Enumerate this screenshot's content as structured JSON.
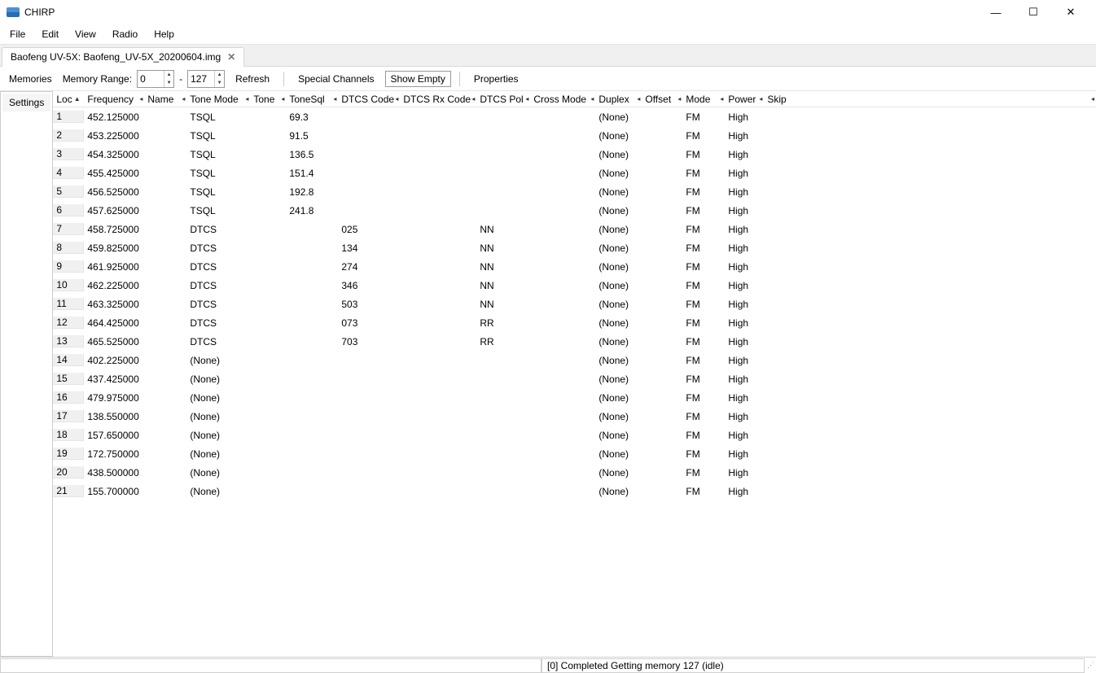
{
  "title": "CHIRP",
  "menu": {
    "file": "File",
    "edit": "Edit",
    "view": "View",
    "radio": "Radio",
    "help": "Help"
  },
  "tab": {
    "label": "Baofeng UV-5X: Baofeng_UV-5X_20200604.img"
  },
  "toolbar": {
    "memories": "Memories",
    "memory_range": "Memory Range:",
    "range_from": "0",
    "dash": "-",
    "range_to": "127",
    "refresh": "Refresh",
    "special_channels": "Special Channels",
    "show_empty": "Show Empty",
    "properties": "Properties"
  },
  "sidebar": {
    "settings": "Settings"
  },
  "columns": {
    "loc": "Loc",
    "frequency": "Frequency",
    "name": "Name",
    "tone_mode": "Tone Mode",
    "tone": "Tone",
    "tone_sql": "ToneSql",
    "dtcs_code": "DTCS Code",
    "dtcs_rx_code": "DTCS Rx Code",
    "dtcs_pol": "DTCS Pol",
    "cross_mode": "Cross Mode",
    "duplex": "Duplex",
    "offset": "Offset",
    "mode": "Mode",
    "power": "Power",
    "skip": "Skip"
  },
  "rows": [
    {
      "loc": "1",
      "freq": "452.125000",
      "name": "",
      "tmode": "TSQL",
      "tone": "",
      "tsql": "69.3",
      "dtcs": "",
      "dtcsrx": "",
      "dtcspol": "",
      "cross": "",
      "duplex": "(None)",
      "offset": "",
      "mode": "FM",
      "power": "High",
      "skip": ""
    },
    {
      "loc": "2",
      "freq": "453.225000",
      "name": "",
      "tmode": "TSQL",
      "tone": "",
      "tsql": "91.5",
      "dtcs": "",
      "dtcsrx": "",
      "dtcspol": "",
      "cross": "",
      "duplex": "(None)",
      "offset": "",
      "mode": "FM",
      "power": "High",
      "skip": ""
    },
    {
      "loc": "3",
      "freq": "454.325000",
      "name": "",
      "tmode": "TSQL",
      "tone": "",
      "tsql": "136.5",
      "dtcs": "",
      "dtcsrx": "",
      "dtcspol": "",
      "cross": "",
      "duplex": "(None)",
      "offset": "",
      "mode": "FM",
      "power": "High",
      "skip": ""
    },
    {
      "loc": "4",
      "freq": "455.425000",
      "name": "",
      "tmode": "TSQL",
      "tone": "",
      "tsql": "151.4",
      "dtcs": "",
      "dtcsrx": "",
      "dtcspol": "",
      "cross": "",
      "duplex": "(None)",
      "offset": "",
      "mode": "FM",
      "power": "High",
      "skip": ""
    },
    {
      "loc": "5",
      "freq": "456.525000",
      "name": "",
      "tmode": "TSQL",
      "tone": "",
      "tsql": "192.8",
      "dtcs": "",
      "dtcsrx": "",
      "dtcspol": "",
      "cross": "",
      "duplex": "(None)",
      "offset": "",
      "mode": "FM",
      "power": "High",
      "skip": ""
    },
    {
      "loc": "6",
      "freq": "457.625000",
      "name": "",
      "tmode": "TSQL",
      "tone": "",
      "tsql": "241.8",
      "dtcs": "",
      "dtcsrx": "",
      "dtcspol": "",
      "cross": "",
      "duplex": "(None)",
      "offset": "",
      "mode": "FM",
      "power": "High",
      "skip": ""
    },
    {
      "loc": "7",
      "freq": "458.725000",
      "name": "",
      "tmode": "DTCS",
      "tone": "",
      "tsql": "",
      "dtcs": "025",
      "dtcsrx": "",
      "dtcspol": "NN",
      "cross": "",
      "duplex": "(None)",
      "offset": "",
      "mode": "FM",
      "power": "High",
      "skip": ""
    },
    {
      "loc": "8",
      "freq": "459.825000",
      "name": "",
      "tmode": "DTCS",
      "tone": "",
      "tsql": "",
      "dtcs": "134",
      "dtcsrx": "",
      "dtcspol": "NN",
      "cross": "",
      "duplex": "(None)",
      "offset": "",
      "mode": "FM",
      "power": "High",
      "skip": ""
    },
    {
      "loc": "9",
      "freq": "461.925000",
      "name": "",
      "tmode": "DTCS",
      "tone": "",
      "tsql": "",
      "dtcs": "274",
      "dtcsrx": "",
      "dtcspol": "NN",
      "cross": "",
      "duplex": "(None)",
      "offset": "",
      "mode": "FM",
      "power": "High",
      "skip": ""
    },
    {
      "loc": "10",
      "freq": "462.225000",
      "name": "",
      "tmode": "DTCS",
      "tone": "",
      "tsql": "",
      "dtcs": "346",
      "dtcsrx": "",
      "dtcspol": "NN",
      "cross": "",
      "duplex": "(None)",
      "offset": "",
      "mode": "FM",
      "power": "High",
      "skip": ""
    },
    {
      "loc": "11",
      "freq": "463.325000",
      "name": "",
      "tmode": "DTCS",
      "tone": "",
      "tsql": "",
      "dtcs": "503",
      "dtcsrx": "",
      "dtcspol": "NN",
      "cross": "",
      "duplex": "(None)",
      "offset": "",
      "mode": "FM",
      "power": "High",
      "skip": ""
    },
    {
      "loc": "12",
      "freq": "464.425000",
      "name": "",
      "tmode": "DTCS",
      "tone": "",
      "tsql": "",
      "dtcs": "073",
      "dtcsrx": "",
      "dtcspol": "RR",
      "cross": "",
      "duplex": "(None)",
      "offset": "",
      "mode": "FM",
      "power": "High",
      "skip": ""
    },
    {
      "loc": "13",
      "freq": "465.525000",
      "name": "",
      "tmode": "DTCS",
      "tone": "",
      "tsql": "",
      "dtcs": "703",
      "dtcsrx": "",
      "dtcspol": "RR",
      "cross": "",
      "duplex": "(None)",
      "offset": "",
      "mode": "FM",
      "power": "High",
      "skip": ""
    },
    {
      "loc": "14",
      "freq": "402.225000",
      "name": "",
      "tmode": "(None)",
      "tone": "",
      "tsql": "",
      "dtcs": "",
      "dtcsrx": "",
      "dtcspol": "",
      "cross": "",
      "duplex": "(None)",
      "offset": "",
      "mode": "FM",
      "power": "High",
      "skip": ""
    },
    {
      "loc": "15",
      "freq": "437.425000",
      "name": "",
      "tmode": "(None)",
      "tone": "",
      "tsql": "",
      "dtcs": "",
      "dtcsrx": "",
      "dtcspol": "",
      "cross": "",
      "duplex": "(None)",
      "offset": "",
      "mode": "FM",
      "power": "High",
      "skip": ""
    },
    {
      "loc": "16",
      "freq": "479.975000",
      "name": "",
      "tmode": "(None)",
      "tone": "",
      "tsql": "",
      "dtcs": "",
      "dtcsrx": "",
      "dtcspol": "",
      "cross": "",
      "duplex": "(None)",
      "offset": "",
      "mode": "FM",
      "power": "High",
      "skip": ""
    },
    {
      "loc": "17",
      "freq": "138.550000",
      "name": "",
      "tmode": "(None)",
      "tone": "",
      "tsql": "",
      "dtcs": "",
      "dtcsrx": "",
      "dtcspol": "",
      "cross": "",
      "duplex": "(None)",
      "offset": "",
      "mode": "FM",
      "power": "High",
      "skip": ""
    },
    {
      "loc": "18",
      "freq": "157.650000",
      "name": "",
      "tmode": "(None)",
      "tone": "",
      "tsql": "",
      "dtcs": "",
      "dtcsrx": "",
      "dtcspol": "",
      "cross": "",
      "duplex": "(None)",
      "offset": "",
      "mode": "FM",
      "power": "High",
      "skip": ""
    },
    {
      "loc": "19",
      "freq": "172.750000",
      "name": "",
      "tmode": "(None)",
      "tone": "",
      "tsql": "",
      "dtcs": "",
      "dtcsrx": "",
      "dtcspol": "",
      "cross": "",
      "duplex": "(None)",
      "offset": "",
      "mode": "FM",
      "power": "High",
      "skip": ""
    },
    {
      "loc": "20",
      "freq": "438.500000",
      "name": "",
      "tmode": "(None)",
      "tone": "",
      "tsql": "",
      "dtcs": "",
      "dtcsrx": "",
      "dtcspol": "",
      "cross": "",
      "duplex": "(None)",
      "offset": "",
      "mode": "FM",
      "power": "High",
      "skip": ""
    },
    {
      "loc": "21",
      "freq": "155.700000",
      "name": "",
      "tmode": "(None)",
      "tone": "",
      "tsql": "",
      "dtcs": "",
      "dtcsrx": "",
      "dtcspol": "",
      "cross": "",
      "duplex": "(None)",
      "offset": "",
      "mode": "FM",
      "power": "High",
      "skip": ""
    }
  ],
  "status": "[0] Completed Getting memory 127 (idle)"
}
